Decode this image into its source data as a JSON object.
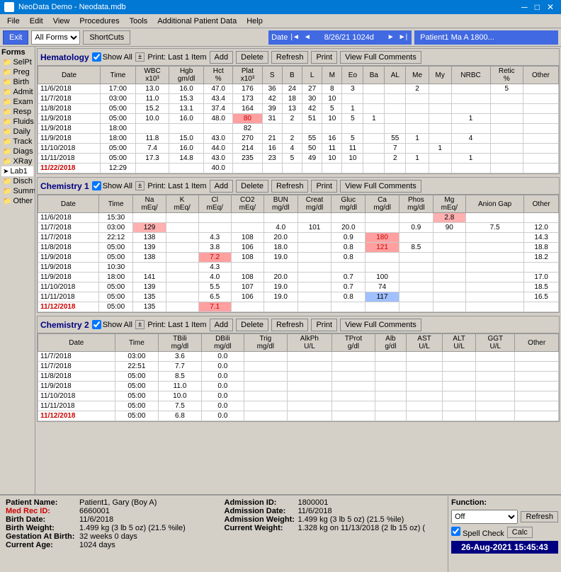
{
  "titlebar": {
    "title": "NeoData Demo - Neodata.mdb",
    "controls": [
      "_",
      "□",
      "✕"
    ]
  },
  "menubar": {
    "items": [
      "File",
      "Edit",
      "View",
      "Procedures",
      "Tools",
      "Additional Patient Data",
      "Help"
    ]
  },
  "toolbar": {
    "exit_label": "Exit",
    "form_select_value": "All Forms",
    "shortcuts_label": "ShortCuts",
    "date_label": "Date",
    "current_date": "8/26/21  1024d",
    "patient_name": "Patient1  Ma  A  1800..."
  },
  "sidebar": {
    "section_label": "Forms",
    "items": [
      {
        "label": "SelPt",
        "active": false
      },
      {
        "label": "Preg",
        "active": false
      },
      {
        "label": "Birth",
        "active": false
      },
      {
        "label": "Admit",
        "active": false
      },
      {
        "label": "Exam",
        "active": false
      },
      {
        "label": "Resp",
        "active": false
      },
      {
        "label": "Fluids",
        "active": false
      },
      {
        "label": "Daily",
        "active": false
      },
      {
        "label": "Track",
        "active": false
      },
      {
        "label": "Diags",
        "active": false
      },
      {
        "label": "XRay",
        "active": false
      },
      {
        "label": "Lab1",
        "active": true
      },
      {
        "label": "Disch",
        "active": false
      },
      {
        "label": "Summ",
        "active": false
      },
      {
        "label": "Other",
        "active": false
      }
    ]
  },
  "hematology": {
    "title": "Hematology",
    "show_all": true,
    "print_label": "Print: Last 1 Item",
    "buttons": [
      "Add",
      "Delete",
      "Refresh",
      "Print",
      "View Full Comments"
    ],
    "columns": [
      "Date",
      "Time",
      "WBC x10^3",
      "Hgb gm/dl",
      "Hct %",
      "Plat x10^3",
      "S",
      "B",
      "L",
      "M",
      "Eo",
      "Ba",
      "AL",
      "Me",
      "My",
      "NRBC",
      "Retic %",
      "Other"
    ],
    "rows": [
      {
        "date": "11/6/2018",
        "time": "17:00",
        "wbc": "13.0",
        "hgb": "16.0",
        "hct": "47.0",
        "plat": "176",
        "s": "36",
        "b": "24",
        "l": "27",
        "m": "8",
        "eo": "3",
        "ba": "",
        "al": "",
        "me": "2",
        "my": "",
        "nrbc": "",
        "retic": "5",
        "other": "",
        "date_red": false
      },
      {
        "date": "11/7/2018",
        "time": "03:00",
        "wbc": "11.0",
        "hgb": "15.3",
        "hct": "43.4",
        "plat": "173",
        "s": "42",
        "b": "18",
        "l": "30",
        "m": "10",
        "eo": "",
        "ba": "",
        "al": "",
        "me": "",
        "my": "",
        "nrbc": "",
        "retic": "",
        "other": "",
        "date_red": false
      },
      {
        "date": "11/8/2018",
        "time": "05:00",
        "wbc": "15.2",
        "hgb": "13.1",
        "hct": "37.4",
        "plat": "164",
        "s": "39",
        "b": "13",
        "l": "42",
        "m": "5",
        "eo": "1",
        "ba": "",
        "al": "",
        "me": "",
        "my": "",
        "nrbc": "",
        "retic": "",
        "other": "",
        "date_red": false
      },
      {
        "date": "11/9/2018",
        "time": "05:00",
        "wbc": "10.0",
        "hgb": "16.0",
        "hct": "48.0",
        "plat": "80",
        "s": "31",
        "b": "2",
        "l": "51",
        "m": "10",
        "eo": "5",
        "ba": "1",
        "al": "",
        "me": "",
        "my": "",
        "nrbc": "1",
        "retic": "",
        "other": "",
        "date_red": false,
        "plat_high": true
      },
      {
        "date": "11/9/2018",
        "time": "18:00",
        "wbc": "",
        "hgb": "",
        "hct": "",
        "plat": "82",
        "s": "",
        "b": "",
        "l": "",
        "m": "",
        "eo": "",
        "ba": "",
        "al": "",
        "me": "",
        "my": "",
        "nrbc": "",
        "retic": "",
        "other": "",
        "date_red": false
      },
      {
        "date": "11/9/2018",
        "time": "18:00",
        "wbc": "11.8",
        "hgb": "15.0",
        "hct": "43.0",
        "plat": "270",
        "s": "21",
        "b": "2",
        "l": "55",
        "m": "16",
        "eo": "5",
        "ba": "",
        "al": "55",
        "me": "1",
        "my": "",
        "nrbc": "4",
        "retic": "",
        "other": "",
        "date_red": false
      },
      {
        "date": "11/10/2018",
        "time": "05:00",
        "wbc": "7.4",
        "hgb": "16.0",
        "hct": "44.0",
        "plat": "214",
        "s": "16",
        "b": "4",
        "l": "50",
        "m": "11",
        "eo": "11",
        "ba": "",
        "al": "7",
        "me": "",
        "my": "1",
        "nrbc": "",
        "retic": "",
        "other": "",
        "date_red": false
      },
      {
        "date": "11/11/2018",
        "time": "05:00",
        "wbc": "17.3",
        "hgb": "14.8",
        "hct": "43.0",
        "plat": "235",
        "s": "23",
        "b": "5",
        "l": "49",
        "m": "10",
        "eo": "10",
        "ba": "",
        "al": "2",
        "me": "1",
        "my": "",
        "nrbc": "1",
        "retic": "",
        "other": "",
        "date_red": false
      },
      {
        "date": "11/22/2018",
        "time": "12:29",
        "wbc": "",
        "hgb": "",
        "hct": "40.0",
        "plat": "",
        "s": "",
        "b": "",
        "l": "",
        "m": "",
        "eo": "",
        "ba": "",
        "al": "",
        "me": "",
        "my": "",
        "nrbc": "",
        "retic": "",
        "other": "",
        "date_red": true
      }
    ]
  },
  "chemistry1": {
    "title": "Chemistry 1",
    "show_all": true,
    "print_label": "Print: Last 1 Item",
    "buttons": [
      "Add",
      "Delete",
      "Refresh",
      "Print",
      "View Full Comments"
    ],
    "columns": [
      "Date",
      "Time",
      "Na mEq/",
      "K mEq/",
      "Cl mEq/",
      "CO2 mEq/",
      "BUN mg/dl",
      "Creat mg/dl",
      "Gluc mg/dl",
      "Ca mg/dl",
      "Phos mg/dl",
      "Mg mEq/",
      "Anion Gap",
      "Other"
    ],
    "rows": [
      {
        "date": "11/6/2018",
        "time": "15:30",
        "na": "",
        "k": "",
        "cl": "",
        "co2": "",
        "bun": "",
        "creat": "",
        "gluc": "",
        "ca": "",
        "phos": "",
        "mg": "2.8",
        "ag": "",
        "other": "",
        "date_red": false,
        "mg_high": true
      },
      {
        "date": "11/7/2018",
        "time": "03:00",
        "na": "129",
        "k": "",
        "cl": "",
        "co2": "",
        "bun": "4.0",
        "creat": "101",
        "gluc": "20.0",
        "ca": "",
        "phos": "0.9",
        "mg": "90",
        "ag": "7.5",
        "other": "12.0",
        "date_red": false,
        "na_low": true,
        "gluc_low": true
      },
      {
        "date": "11/7/2018",
        "time": "22:12",
        "na": "138",
        "k": "",
        "cl": "4.3",
        "co2": "108",
        "bun": "20.0",
        "creat": "",
        "gluc": "0.9",
        "ca": "180",
        "phos": "",
        "mg": "",
        "ag": "",
        "other": "14.3",
        "date_red": false,
        "gluc_red": false,
        "ca_high": true
      },
      {
        "date": "11/8/2018",
        "time": "05:00",
        "na": "139",
        "k": "",
        "cl": "3.8",
        "co2": "106",
        "bun": "18.0",
        "creat": "",
        "gluc": "0.8",
        "ca": "121",
        "phos": "8.5",
        "mg": "",
        "ag": "",
        "other": "18.8",
        "date_red": false,
        "ca_med": true
      },
      {
        "date": "11/9/2018",
        "time": "05:00",
        "na": "138",
        "k": "",
        "cl": "7.2",
        "co2": "108",
        "bun": "19.0",
        "creat": "",
        "gluc": "0.8",
        "ca": "",
        "phos": "",
        "mg": "",
        "ag": "",
        "other": "18.2",
        "date_red": false,
        "k_high": true
      },
      {
        "date": "11/9/2018",
        "time": "10:30",
        "na": "",
        "k": "",
        "cl": "4.3",
        "co2": "",
        "bun": "",
        "creat": "",
        "gluc": "",
        "ca": "",
        "phos": "",
        "mg": "",
        "ag": "",
        "other": "",
        "date_red": false
      },
      {
        "date": "11/9/2018",
        "time": "18:00",
        "na": "141",
        "k": "",
        "cl": "4.0",
        "co2": "108",
        "bun": "20.0",
        "creat": "",
        "gluc": "0.7",
        "ca": "100",
        "phos": "",
        "mg": "",
        "ag": "",
        "other": "17.0",
        "date_red": false
      },
      {
        "date": "11/10/2018",
        "time": "05:00",
        "na": "139",
        "k": "",
        "cl": "5.5",
        "co2": "107",
        "bun": "19.0",
        "creat": "",
        "gluc": "0.7",
        "ca": "74",
        "phos": "",
        "mg": "",
        "ag": "",
        "other": "18.5",
        "date_red": false
      },
      {
        "date": "11/11/2018",
        "time": "05:00",
        "na": "135",
        "k": "",
        "cl": "6.5",
        "co2": "106",
        "bun": "19.0",
        "creat": "",
        "gluc": "0.8",
        "ca": "117",
        "phos": "",
        "mg": "",
        "ag": "",
        "other": "16.5",
        "date_red": false,
        "ca_blue": true
      },
      {
        "date": "11/12/2018",
        "time": "05:00",
        "na": "135",
        "k": "",
        "cl": "7.1",
        "co2": "",
        "bun": "",
        "creat": "",
        "gluc": "",
        "ca": "",
        "phos": "",
        "mg": "",
        "ag": "",
        "other": "",
        "date_red": true,
        "k_high2": true
      }
    ]
  },
  "chemistry2": {
    "title": "Chemistry 2",
    "show_all": true,
    "print_label": "Print: Last 1 Item",
    "buttons": [
      "Add",
      "Delete",
      "Refresh",
      "Print",
      "View Full Comments"
    ],
    "columns": [
      "Date",
      "Time",
      "TBili mg/dl",
      "DBili mg/dl",
      "Trig mg/dl",
      "AlkPh U/L",
      "TProt g/dl",
      "Alb g/dl",
      "AST U/L",
      "ALT U/L",
      "GGT U/L",
      "Other"
    ],
    "rows": [
      {
        "date": "11/7/2018",
        "time": "03:00",
        "tbili": "3.6",
        "dbili": "0.0",
        "trig": "",
        "alkph": "",
        "tprot": "",
        "alb": "",
        "ast": "",
        "alt": "",
        "ggt": "",
        "other": "",
        "date_red": false
      },
      {
        "date": "11/7/2018",
        "time": "22:51",
        "tbili": "7.7",
        "dbili": "0.0",
        "trig": "",
        "alkph": "",
        "tprot": "",
        "alb": "",
        "ast": "",
        "alt": "",
        "ggt": "",
        "other": "",
        "date_red": false
      },
      {
        "date": "11/8/2018",
        "time": "05:00",
        "tbili": "8.5",
        "dbili": "0.0",
        "trig": "",
        "alkph": "",
        "tprot": "",
        "alb": "",
        "ast": "",
        "alt": "",
        "ggt": "",
        "other": "",
        "date_red": false
      },
      {
        "date": "11/9/2018",
        "time": "05:00",
        "tbili": "11.0",
        "dbili": "0.0",
        "trig": "",
        "alkph": "",
        "tprot": "",
        "alb": "",
        "ast": "",
        "alt": "",
        "ggt": "",
        "other": "",
        "date_red": false
      },
      {
        "date": "11/10/2018",
        "time": "05:00",
        "tbili": "10.0",
        "dbili": "0.0",
        "trig": "",
        "alkph": "",
        "tprot": "",
        "alb": "",
        "ast": "",
        "alt": "",
        "ggt": "",
        "other": "",
        "date_red": false
      },
      {
        "date": "11/11/2018",
        "time": "05:00",
        "tbili": "7.5",
        "dbili": "0.0",
        "trig": "",
        "alkph": "",
        "tprot": "",
        "alb": "",
        "ast": "",
        "alt": "",
        "ggt": "",
        "other": "",
        "date_red": false
      },
      {
        "date": "11/12/2018",
        "time": "05:00",
        "tbili": "6.8",
        "dbili": "0.0",
        "trig": "",
        "alkph": "",
        "tprot": "",
        "alb": "",
        "ast": "",
        "alt": "",
        "ggt": "",
        "other": "",
        "date_red": true
      }
    ]
  },
  "statusbar": {
    "patient_name_label": "Patient Name:",
    "patient_name_value": "Patient1, Gary (Boy A)",
    "med_rec_label": "Med Rec ID:",
    "med_rec_value": "6660001",
    "birth_date_label": "Birth Date:",
    "birth_date_value": "11/6/2018",
    "birth_weight_label": "Birth Weight:",
    "birth_weight_value": "1.499 kg (3 lb 5 oz) (21.5 %ile)",
    "gestation_label": "Gestation At Birth:",
    "gestation_value": "32 weeks 0 days",
    "current_age_label": "Current Age:",
    "current_age_value": "1024 days",
    "admission_id_label": "Admission ID:",
    "admission_id_value": "1800001",
    "admission_date_label": "Admission Date:",
    "admission_date_value": "11/6/2018",
    "admission_weight_label": "Admission Weight:",
    "admission_weight_value": "1.499 kg (3 lb 5 oz) (21.5 %ile)",
    "current_weight_label": "Current Weight:",
    "current_weight_value": "1.328 kg on 11/13/2018 (2 lb 15 oz) (",
    "function_label": "Function:",
    "function_value": "Off",
    "refresh_label": "Refresh",
    "spell_check_label": "Spell Check",
    "calc_label": "Calc",
    "datetime": "26-Aug-2021  15:45:43"
  }
}
